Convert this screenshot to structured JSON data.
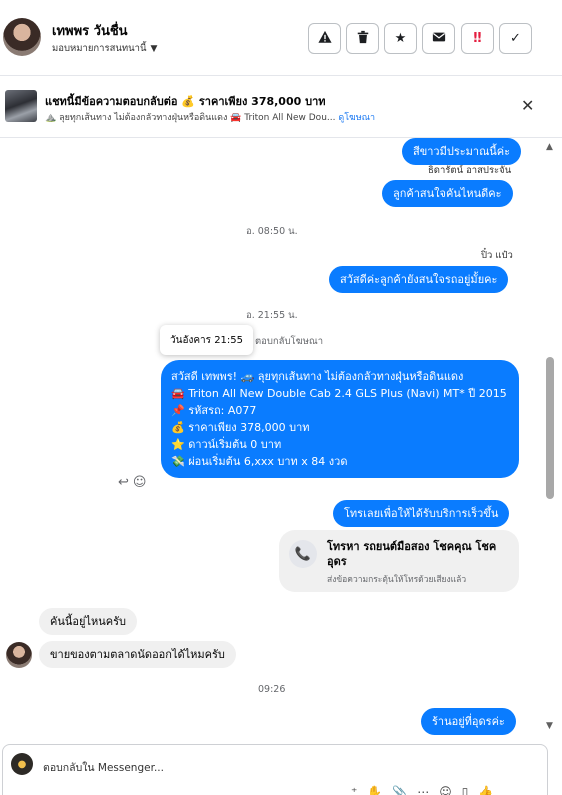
{
  "header": {
    "name": "เทพพร วันชื่น",
    "assign": "มอบหมายการสนทนานี้",
    "actions": [
      "report",
      "delete",
      "star",
      "mail",
      "spam",
      "done"
    ]
  },
  "ad": {
    "title": "แชทนี้มีข้อความตอบกลับต่อ 💰 ราคาเพียง 378,000 บาท",
    "sub": "⛰️ ลุยทุกเส้นทาง ไม่ต้องกลัวทางฝุ่นหรือดินแดง 🚘 Triton All New Dou...",
    "link": "ดูโฆษณา"
  },
  "chat": {
    "m1": "สีขาวมีประมาณนี้ค่ะ",
    "sender1": "ธิดารัตน์ อาสประจัน",
    "m2": "ลูกค้าสนใจคันไหนดีคะ",
    "ts1": "อ. 08:50 น.",
    "sender2": "ปิ๋ว แป๋ว",
    "m3": "สวัสดีค่ะลูกค้ายังสนใจรถอยู่มั้ยคะ",
    "ts2": "อ. 21:55 น.",
    "tooltip": "วันอังคาร 21:55",
    "reply_ad": "ตอบกลับโฆษณา",
    "ad_lines": [
      "สวัสดี เทพพร! 🚙 ลุยทุกเส้นทาง ไม่ต้องกลัวทางฝุ่นหรือดินแดง",
      "🚘 Triton All New Double Cab 2.4 GLS Plus (Navi) MT* ปี 2015",
      "📌 รหัสรถ: A077",
      "💰 ราคาเพียง 378,000 บาท",
      "⭐ ดาวน์เริ่มต้น 0 บาท",
      "💸 ผ่อนเริ่มต้น 6,xxx บาท x 84 งวด"
    ],
    "m4": "โทรเลยเพื่อให้ได้รับบริการเร็วขึ้น",
    "call_title": "โทรหา รถยนต์มือสอง โชคคุณ โชค อุดร",
    "call_sub": "ส่งข้อความกระตุ้นให้โทรด้วยเสียงแล้ว",
    "in1": "คันนี้อยู่ไหนครับ",
    "in2": "ขายของตามตลาดนัดออกได้ไหมครับ",
    "ts3": "09:26",
    "m5": "ร้านอยู่ที่อุดรค่ะ"
  },
  "composer": {
    "placeholder": "ตอบกลับใน Messenger..."
  }
}
